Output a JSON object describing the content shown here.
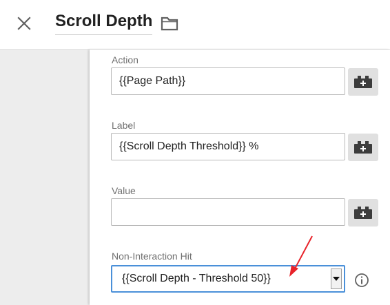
{
  "header": {
    "title": "Scroll Depth",
    "close_icon": "close-icon",
    "folder_icon": "folder-icon"
  },
  "fields": {
    "action": {
      "label": "Action",
      "value": "{{Page Path}}"
    },
    "label": {
      "label": "Label",
      "value": "{{Scroll Depth Threshold}} %"
    },
    "value": {
      "label": "Value",
      "value": ""
    }
  },
  "non_interaction": {
    "label": "Non-Interaction Hit",
    "selected": "{{Scroll Depth - Threshold 50}}"
  },
  "icons": {
    "variable": "variable-picker-icon",
    "info": "info-icon",
    "dropdown": "dropdown-arrow-icon",
    "annotation": "red-arrow-annotation"
  },
  "colors": {
    "select_focus_border": "#4a90d9",
    "annotation_arrow": "#e8232a",
    "gutter": "#ededed",
    "variable_button": "#e0e0e0"
  }
}
